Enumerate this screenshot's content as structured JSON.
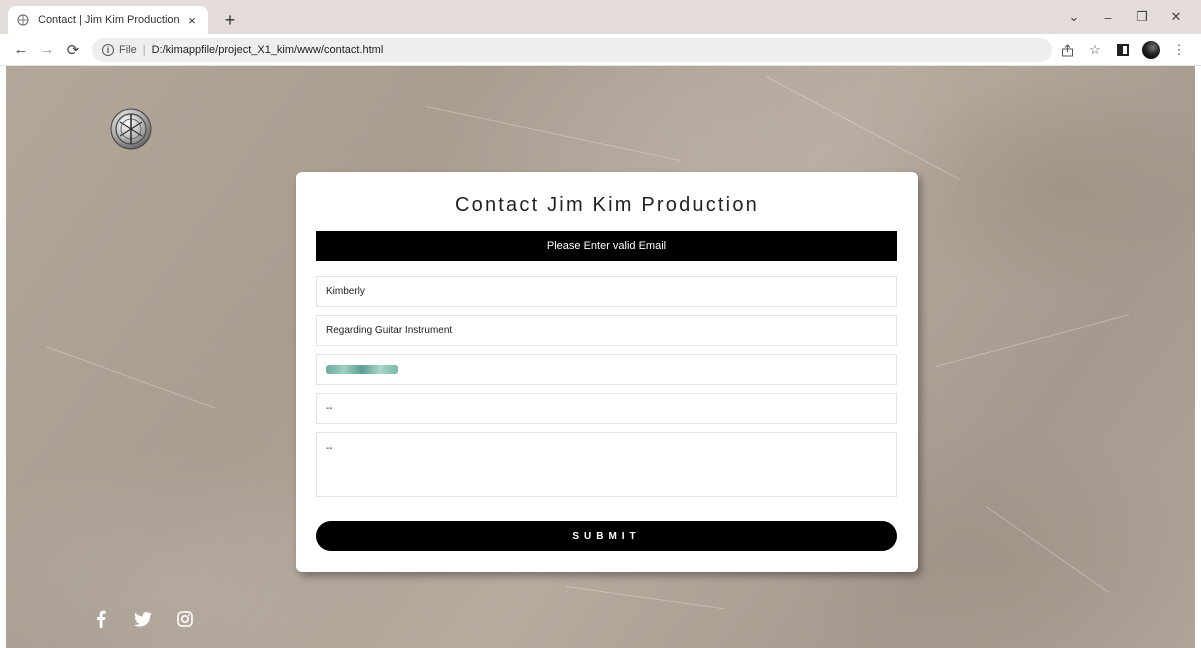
{
  "browser": {
    "tab_title": "Contact | Jim Kim Production",
    "tab_close": "×",
    "new_tab": "+",
    "scheme": "File",
    "separator": "|",
    "url": "D:/kimappfile/project_X1_kim/www/contact.html",
    "window_minimize": "–",
    "window_restore": "❐",
    "window_close": "✕",
    "tab_search": "⌄"
  },
  "contact": {
    "title": "Contact Jim Kim Production",
    "alert": "Please Enter valid Email",
    "name_value": "Kimberly",
    "subject_value": "Regarding Guitar Instrument",
    "phone_value": "--",
    "message_value": "--",
    "submit_label": "SUBMIT"
  },
  "social": {
    "icons": [
      "facebook-icon",
      "twitter-icon",
      "instagram-icon"
    ],
    "icon_color": "#ffffff"
  },
  "colors": {
    "alert_bg": "#000000",
    "submit_bg": "#000000",
    "card_bg": "#ffffff"
  }
}
